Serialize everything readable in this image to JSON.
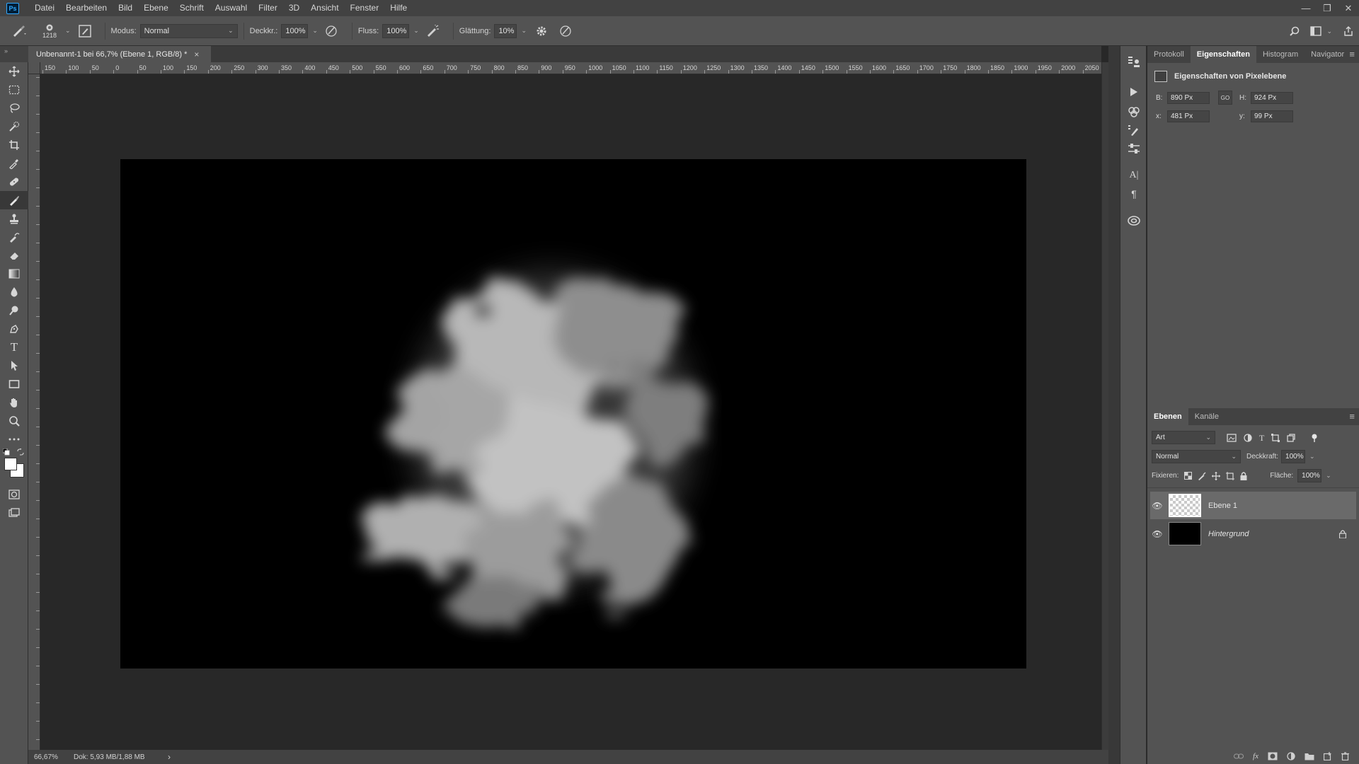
{
  "app": {
    "logo": "Ps"
  },
  "menubar": {
    "items": [
      "Datei",
      "Bearbeiten",
      "Bild",
      "Ebene",
      "Schrift",
      "Auswahl",
      "Filter",
      "3D",
      "Ansicht",
      "Fenster",
      "Hilfe"
    ]
  },
  "window_controls": {
    "minimize": "—",
    "restore": "❐",
    "close": "✕"
  },
  "options": {
    "brush_size": "1218",
    "mode_label": "Modus:",
    "mode_value": "Normal",
    "opacity_label": "Deckkr.:",
    "opacity_value": "100%",
    "flow_label": "Fluss:",
    "flow_value": "100%",
    "smoothing_label": "Glättung:",
    "smoothing_value": "10%"
  },
  "document": {
    "tab_title": "Unbenannt-1 bei 66,7% (Ebene 1, RGB/8) *",
    "tab_close": "×",
    "background_color": "#000000"
  },
  "ruler": {
    "top_labels": [
      "150",
      "100",
      "50",
      "0",
      "50",
      "100",
      "150",
      "200",
      "250",
      "300",
      "350",
      "400",
      "450",
      "500",
      "550",
      "600",
      "650",
      "700",
      "750",
      "800",
      "850",
      "900",
      "950",
      "1000",
      "1050",
      "1100",
      "1150",
      "1200",
      "1250",
      "1300",
      "1350",
      "1400",
      "1450",
      "1500",
      "1550",
      "1600",
      "1650",
      "1700",
      "1750",
      "1800",
      "1850",
      "1900",
      "1950",
      "2000",
      "2050"
    ]
  },
  "statusbar": {
    "zoom": "66,67%",
    "doc_info": "Dok: 5,93 MB/1,88 MB",
    "arrow": "›"
  },
  "properties_panel": {
    "tabs": [
      "Protokoll",
      "Eigenschaften",
      "Histogram",
      "Navigator"
    ],
    "active_tab": "Eigenschaften",
    "header": "Eigenschaften von Pixelebene",
    "b_label": "B:",
    "b_value": "890 Px",
    "h_label": "H:",
    "h_value": "924 Px",
    "x_label": "x:",
    "x_value": "481 Px",
    "y_label": "y:",
    "y_value": "99 Px",
    "link_label": "GO"
  },
  "layers_panel": {
    "tabs": [
      "Ebenen",
      "Kanäle"
    ],
    "active_tab": "Ebenen",
    "filter_value": "Art",
    "blend_mode": "Normal",
    "opacity_label": "Deckkraft:",
    "opacity_value": "100%",
    "lock_label": "Fixieren:",
    "fill_label": "Fläche:",
    "fill_value": "100%",
    "layers": [
      {
        "name": "Ebene 1",
        "selected": true,
        "visible": true,
        "locked": false
      },
      {
        "name": "Hintergrund",
        "selected": false,
        "visible": true,
        "locked": true
      }
    ]
  },
  "icons": {
    "tools": [
      "move-icon",
      "marquee-icon",
      "lasso-icon",
      "quick-select-icon",
      "crop-icon",
      "eyedropper-icon",
      "healing-icon",
      "brush-icon",
      "stamp-icon",
      "history-brush-icon",
      "eraser-icon",
      "gradient-icon",
      "blur-icon",
      "dodge-icon",
      "pen-icon",
      "type-icon",
      "path-select-icon",
      "rectangle-icon",
      "hand-icon",
      "zoom-icon",
      "more-icon"
    ],
    "active_tool": "brush-icon"
  }
}
